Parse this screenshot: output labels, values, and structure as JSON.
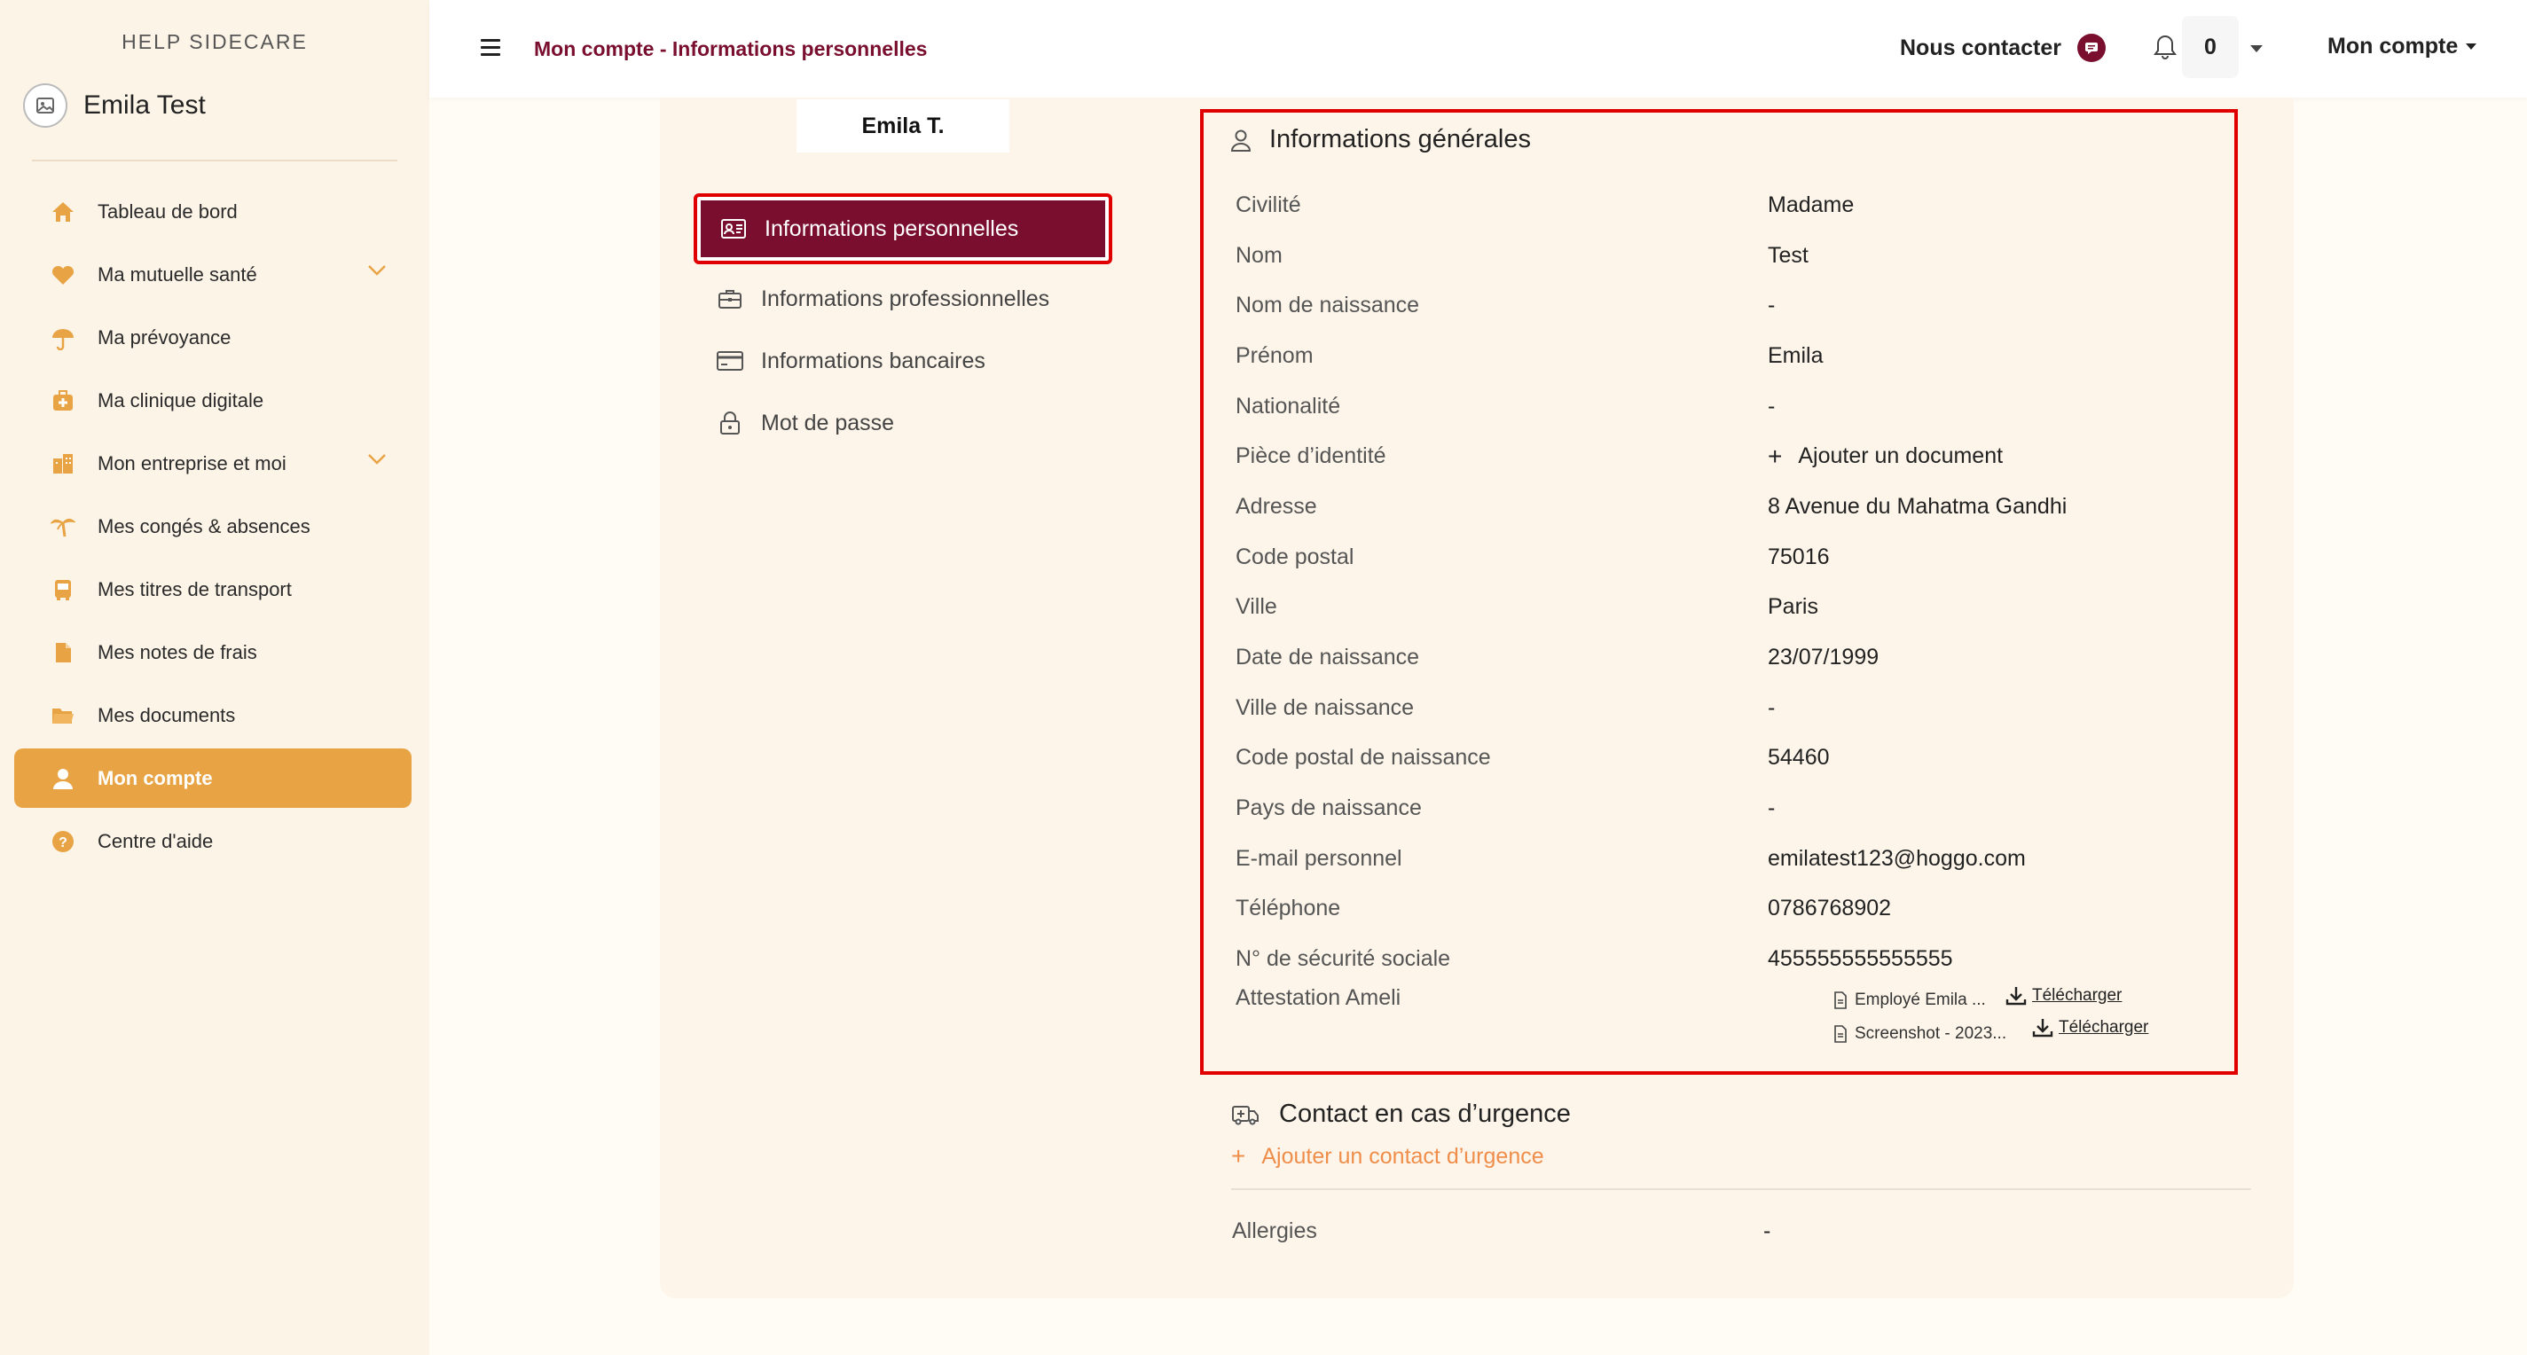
{
  "sidebar": {
    "brand": "HELP SIDECARE",
    "user_name": "Emila Test",
    "items": [
      {
        "label": "Tableau de bord",
        "icon": "home-icon"
      },
      {
        "label": "Ma mutuelle santé",
        "icon": "heart-icon"
      },
      {
        "label": "Ma prévoyance",
        "icon": "umbrella-icon"
      },
      {
        "label": "Ma clinique digitale",
        "icon": "medical-case-icon"
      },
      {
        "label": "Mon entreprise et moi",
        "icon": "building-icon"
      },
      {
        "label": "Mes congés & absences",
        "icon": "palm-tree-icon"
      },
      {
        "label": "Mes titres de transport",
        "icon": "bus-icon"
      },
      {
        "label": "Mes notes de frais",
        "icon": "file-icon"
      },
      {
        "label": "Mes documents",
        "icon": "folder-icon"
      },
      {
        "label": "Mon compte",
        "icon": "user-icon"
      },
      {
        "label": "Centre d'aide",
        "icon": "help-icon"
      }
    ]
  },
  "topbar": {
    "breadcrumb": "Mon compte - Informations personnelles",
    "contact_label": "Nous contacter",
    "notification_count": "0",
    "account_label": "Mon compte"
  },
  "profile": {
    "name_tag": "Emila T."
  },
  "subnav": {
    "items": [
      {
        "label": "Informations personnelles",
        "icon": "id-card-icon"
      },
      {
        "label": "Informations professionnelles",
        "icon": "briefcase-icon"
      },
      {
        "label": "Informations bancaires",
        "icon": "credit-card-icon"
      },
      {
        "label": "Mot de passe",
        "icon": "lock-icon"
      }
    ]
  },
  "general": {
    "title": "Informations générales",
    "rows": [
      {
        "label": "Civilité",
        "value": "Madame"
      },
      {
        "label": "Nom",
        "value": "Test"
      },
      {
        "label": "Nom de naissance",
        "value": "-"
      },
      {
        "label": "Prénom",
        "value": "Emila"
      },
      {
        "label": "Nationalité",
        "value": "-"
      },
      {
        "label": "Pièce d’identité",
        "value": "Ajouter un document"
      },
      {
        "label": "Adresse",
        "value": "8 Avenue du Mahatma Gandhi"
      },
      {
        "label": "Code postal",
        "value": "75016"
      },
      {
        "label": "Ville",
        "value": "Paris"
      },
      {
        "label": "Date de naissance",
        "value": "23/07/1999"
      },
      {
        "label": "Ville de naissance",
        "value": "-"
      },
      {
        "label": "Code postal de naissance",
        "value": "54460"
      },
      {
        "label": "Pays de naissance",
        "value": "-"
      },
      {
        "label": "E-mail personnel",
        "value": "emilatest123@hoggo.com"
      },
      {
        "label": "Téléphone",
        "value": "0786768902"
      },
      {
        "label": "N° de sécurité sociale",
        "value": "455555555555555"
      }
    ],
    "attestation": {
      "label": "Attestation Ameli",
      "files": [
        {
          "name": "Employé Emila ...",
          "download": "Télécharger"
        },
        {
          "name": "Screenshot - 2023...",
          "download": "Télécharger"
        }
      ]
    }
  },
  "emergency": {
    "title": "Contact en cas d’urgence",
    "add_label": "Ajouter un contact d’urgence"
  },
  "allergies": {
    "label": "Allergies",
    "value": "-"
  },
  "colors": {
    "accent": "#e8a444",
    "brand": "#7a0e2e",
    "link_orange": "#ef8e4a",
    "highlight_red": "#e00000"
  }
}
